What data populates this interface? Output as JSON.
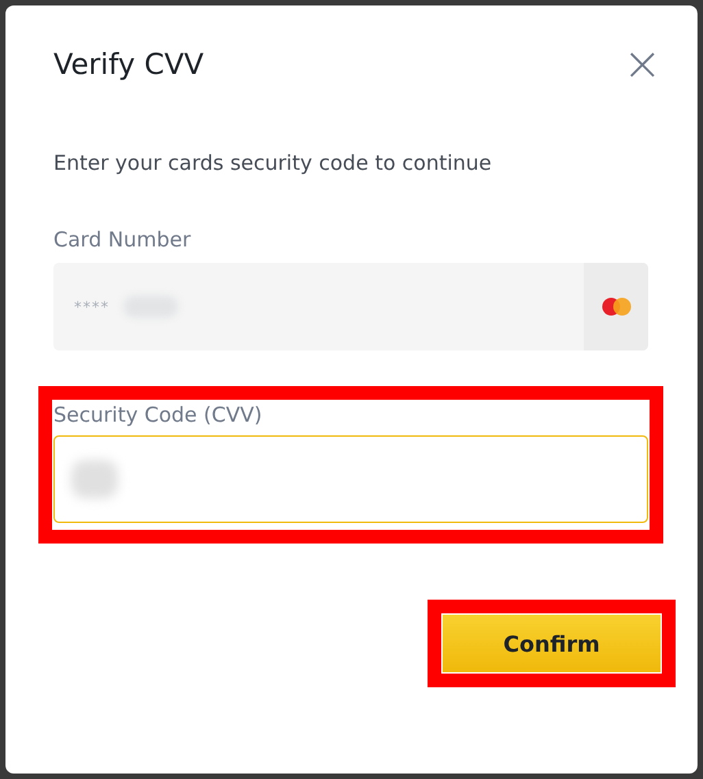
{
  "dialog": {
    "title": "Verify CVV",
    "close_label": "×",
    "description": "Enter your cards security code to continue"
  },
  "card_number": {
    "label": "Card Number",
    "value": "****",
    "redacted": true
  },
  "security_code": {
    "label": "Security Code (CVV)",
    "redacted": true,
    "focused": true,
    "highlighted": true
  },
  "confirm_button": {
    "label": "Confirm",
    "highlighted": true
  }
}
